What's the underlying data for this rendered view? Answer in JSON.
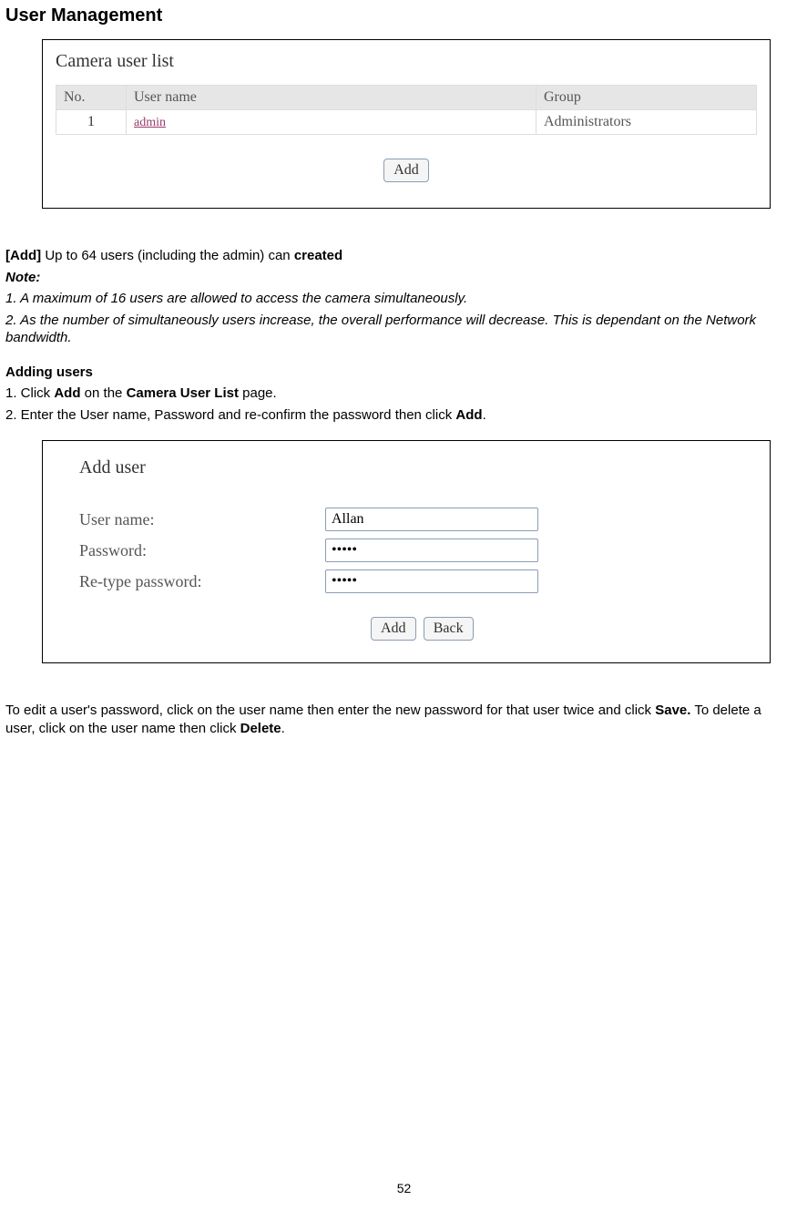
{
  "title": "User Management",
  "screenshot1": {
    "heading": "Camera user list",
    "columns": {
      "no": "No.",
      "username": "User name",
      "group": "Group"
    },
    "rows": [
      {
        "no": "1",
        "username": "admin",
        "group": "Administrators"
      }
    ],
    "add_btn": "Add"
  },
  "desc": {
    "add_label": "[Add]",
    "add_text": " Up to 64 users (including the admin) can ",
    "add_bold_tail": "created",
    "note_label": "Note:",
    "note1": "1. A maximum of 16 users are allowed to access the camera simultaneously.",
    "note2": "2. As the number of simultaneously users increase, the overall performance will decrease. This is dependant on the Network bandwidth."
  },
  "adding": {
    "heading": "Adding users",
    "step1_pre": "1. Click ",
    "step1_b1": "Add",
    "step1_mid": " on the ",
    "step1_b2": "Camera User List",
    "step1_post": " page.",
    "step2_pre": "2. Enter the User name, Password and re-confirm the password then click ",
    "step2_b": "Add",
    "step2_post": "."
  },
  "screenshot2": {
    "heading": "Add user",
    "labels": {
      "username": "User name:",
      "password": "Password:",
      "retype": "Re-type password:"
    },
    "values": {
      "username": "Allan",
      "password": "•••••",
      "retype": "•••••"
    },
    "add_btn": "Add",
    "back_btn": "Back"
  },
  "edit_text": {
    "pre": "To edit a user's password, click on the user name then enter the new password for that user twice and click ",
    "b1": "Save.",
    "mid": " To delete a user, click on the user name then click ",
    "b2": "Delete",
    "post": "."
  },
  "page_number": "52"
}
